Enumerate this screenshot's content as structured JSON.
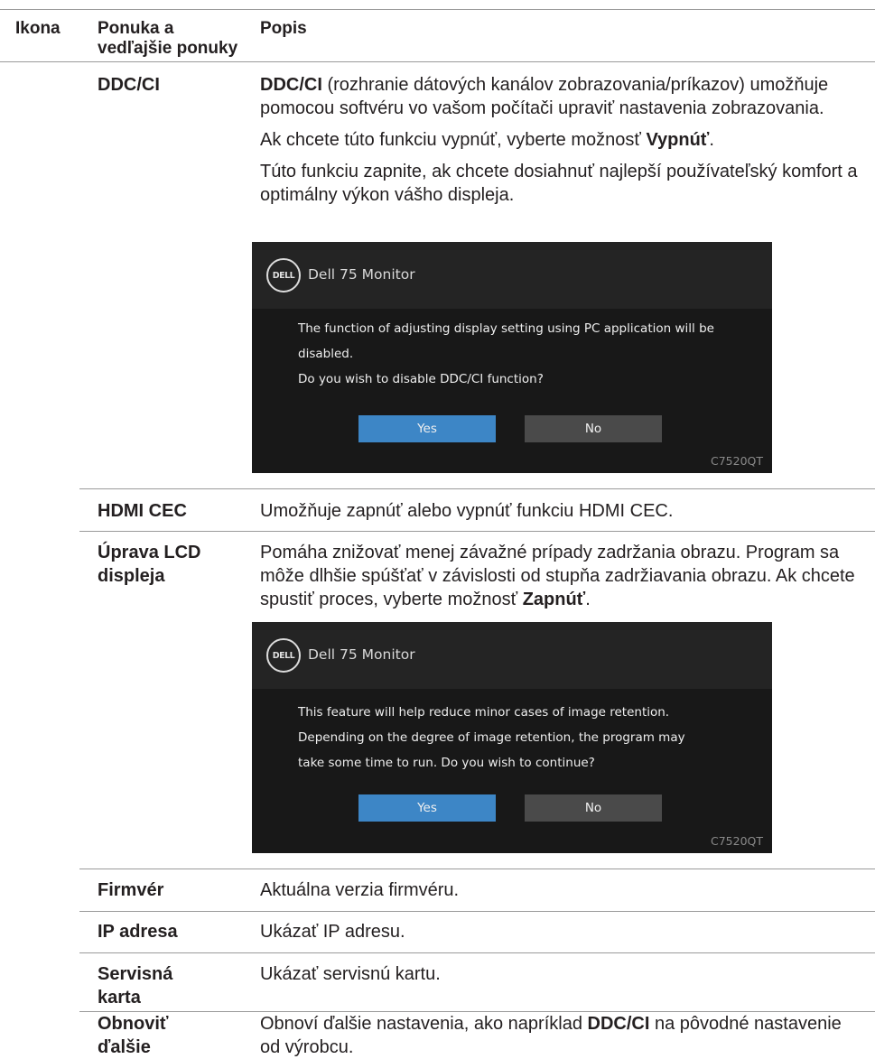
{
  "header": {
    "col_icon": "Ikona",
    "col_menu_line1": "Ponuka a",
    "col_menu_line2": "vedľajšie ponuky",
    "col_desc": "Popis"
  },
  "rows": {
    "ddcci": {
      "menu": "DDC/CI",
      "p1_bold": "DDC/CI",
      "p1_rest": " (rozhranie dátových kanálov zobrazovania/príkazov) umožňuje pomocou softvéru vo vašom počítači upraviť nastavenia zobrazovania.",
      "p2_pre": "Ak chcete túto funkciu vypnúť, vyberte možnosť ",
      "p2_bold": "Vypnúť",
      "p2_post": ".",
      "p3": "Túto funkciu zapnite, ak chcete dosiahnuť najlepší používateľský komfort a optimálny výkon vášho displeja."
    },
    "hdmi_cec": {
      "menu": "HDMI CEC",
      "desc": "Umožňuje zapnúť alebo vypnúť funkciu HDMI CEC."
    },
    "lcd": {
      "menu_line1": "Úprava LCD",
      "menu_line2": "displeja",
      "p1_pre": "Pomáha znižovať menej závažné prípady zadržania obrazu. Program sa môže dlhšie spúšťať v závislosti od stupňa zadržiavania obrazu. Ak chcete spustiť proces, vyberte možnosť ",
      "p1_bold": "Zapnúť",
      "p1_post": "."
    },
    "firmware": {
      "menu": "Firmvér",
      "desc": "Aktuálna verzia firmvéru."
    },
    "ip": {
      "menu": "IP adresa",
      "desc": "Ukázať IP adresu."
    },
    "service": {
      "menu_line1": "Servisná",
      "menu_line2": "karta",
      "desc": "Ukázať servisnú kartu."
    },
    "reset": {
      "menu_line1": "Obnoviť",
      "menu_line2": "ďalšie",
      "desc_pre": "Obnoví ďalšie nastavenia, ako napríklad ",
      "desc_bold": "DDC/CI",
      "desc_post": " na pôvodné nastavenie od výrobcu."
    }
  },
  "osd1": {
    "logo": "DELL",
    "title": "Dell 75 Monitor",
    "line1": "The function of adjusting display setting using PC application will be",
    "line2": "disabled.",
    "line3": "Do you wish to disable DDC/CI function?",
    "yes": "Yes",
    "no": "No",
    "model": "C7520QT"
  },
  "osd2": {
    "logo": "DELL",
    "title": "Dell 75 Monitor",
    "line1": "This feature will help reduce minor cases of image retention.",
    "line2": "Depending on the degree of image retention, the program may",
    "line3": "take some time to run. Do you wish to continue?",
    "yes": "Yes",
    "no": "No",
    "model": "C7520QT"
  }
}
